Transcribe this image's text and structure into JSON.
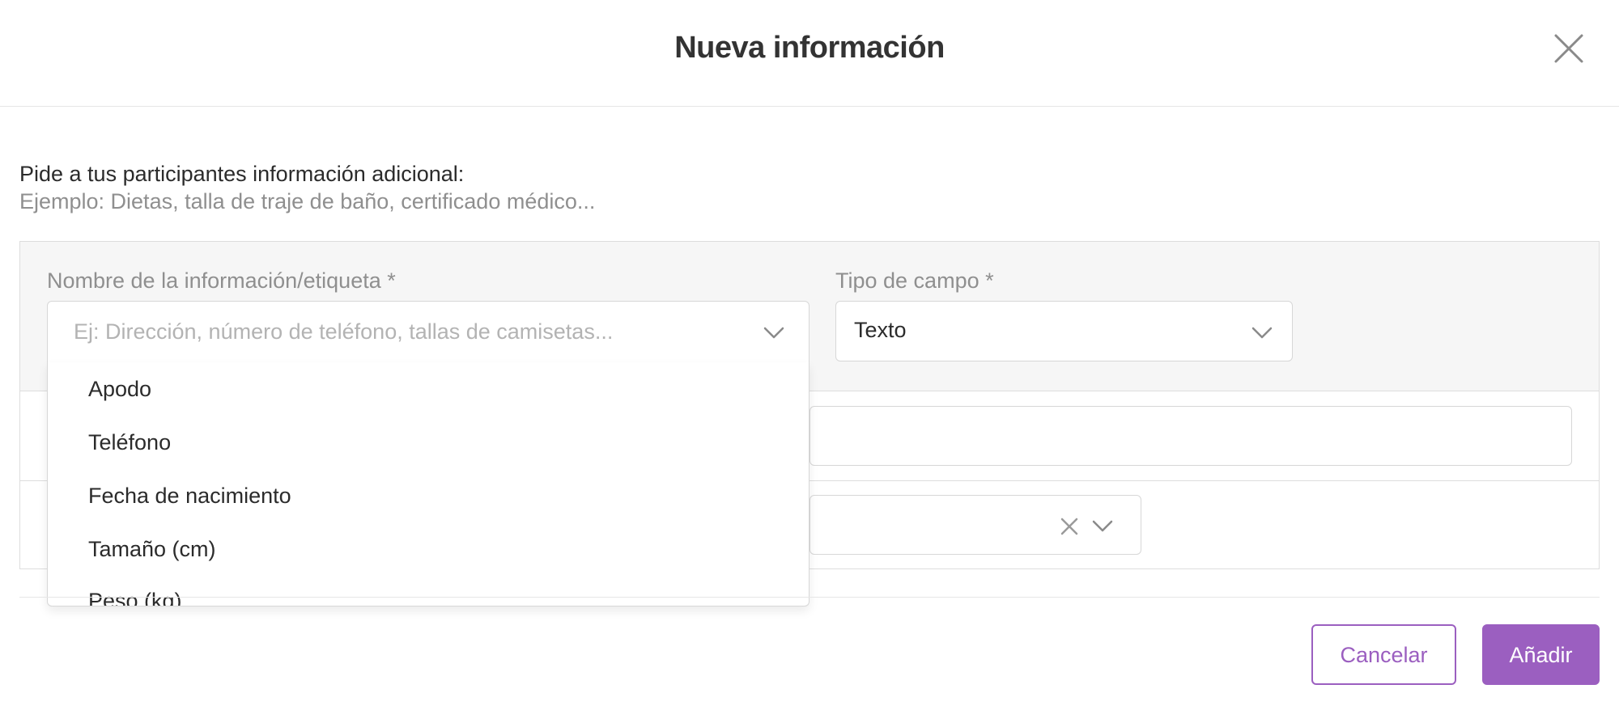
{
  "modal": {
    "title": "Nueva información",
    "close_icon": "close-icon"
  },
  "intro": {
    "line1": "Pide a tus participantes información adicional:",
    "line2": "Ejemplo: Dietas, talla de traje de baño, certificado médico..."
  },
  "form": {
    "name_label": "Nombre de la información/etiqueta *",
    "name_placeholder": "Ej: Dirección, número de teléfono, tallas de camisetas...",
    "type_label": "Tipo de campo *",
    "type_value": "Texto"
  },
  "dropdown": {
    "options": [
      "Apodo",
      "Teléfono",
      "Fecha de nacimiento",
      "Tamaño (cm)",
      "Peso (kg)"
    ]
  },
  "footer": {
    "cancel_label": "Cancelar",
    "add_label": "Añadir"
  },
  "colors": {
    "accent": "#9b5fc0",
    "panel_bg": "#f6f6f6",
    "border": "#d7d7d7",
    "muted_text": "#8f8f8f"
  }
}
